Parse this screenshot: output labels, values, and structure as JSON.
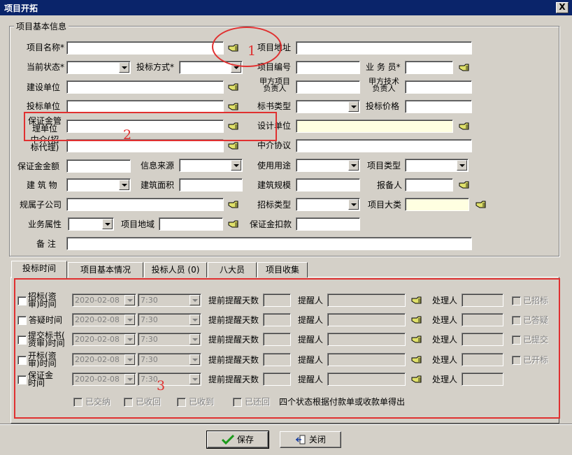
{
  "window": {
    "title": "项目开拓",
    "close_label": "X"
  },
  "group": {
    "title": "项目基本信息"
  },
  "fields": {
    "project_name": "项目名称*",
    "project_addr": "项目地址",
    "status": "当前状态*",
    "bid_method": "投标方式*",
    "project_no": "项目编号",
    "salesman": "业 务 员*",
    "build_unit": "建设单位",
    "owner_pm_1": "甲方项目",
    "owner_pm_2": "负责人",
    "owner_tech_1": "甲方技术",
    "owner_tech_2": "负责人",
    "bid_unit": "投标单位",
    "bid_doc_type": "标书类型",
    "bid_price": "投标价格",
    "deposit_mgr_1": "保证金管",
    "deposit_mgr_2": "理单位",
    "design_unit": "设计单位",
    "agent_1": "中介(招",
    "agent_2": "标代理)",
    "agent_agreement": "中介协议",
    "deposit_amount": "保证金金额",
    "info_source": "信息来源",
    "usage": "使用用途",
    "project_type": "项目类型",
    "building": "建 筑 物",
    "building_area": "建筑面积",
    "building_scale": "建筑规模",
    "reporter": "报备人",
    "subsidiary": "规属子公司",
    "tender_type": "招标类型",
    "project_category": "项目大类",
    "business_attr": "业务属性",
    "project_region": "项目地域",
    "deposit_deduct": "保证金扣款",
    "remark": "备 注"
  },
  "tabs": [
    "投标时间",
    "项目基本情况",
    "投标人员 (0)",
    "八大员",
    "项目收集"
  ],
  "schedule": {
    "rows": [
      {
        "label_1": "招标(资",
        "label_2": "审)时间",
        "date": "2020-02-08",
        "time": "7:30",
        "status": "已招标"
      },
      {
        "label_1": "答疑时间",
        "label_2": "",
        "date": "2020-02-08",
        "time": "7:30",
        "status": "已答疑"
      },
      {
        "label_1": "提交标书(",
        "label_2": "资审)时间",
        "date": "2020-02-08",
        "time": "7:30",
        "status": "已提交"
      },
      {
        "label_1": "开标(资",
        "label_2": "审)时间",
        "date": "2020-02-08",
        "time": "7:30",
        "status": "已开标"
      },
      {
        "label_1": "保证金",
        "label_2": "时间",
        "date": "2020-02-08",
        "time": "7:30",
        "status": ""
      }
    ],
    "remind_days_label": "提前提醒天数",
    "reminder_label": "提醒人",
    "handler_label": "处理人",
    "deposit_states": [
      "已交纳",
      "已收回",
      "已收到",
      "已还回"
    ],
    "deposit_note": "四个状态根据付款单或收款单得出"
  },
  "annotations": {
    "n1": "1",
    "n2": "2",
    "n3": "3"
  },
  "buttons": {
    "save": "保存",
    "close": "关闭"
  },
  "colors": {
    "annotation": "#e03030",
    "titlebar": "#0a246a",
    "highlight_field": "#ffffe1"
  }
}
